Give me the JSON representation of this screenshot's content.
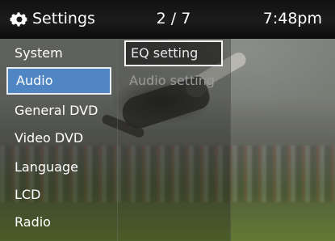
{
  "header": {
    "title": "Settings",
    "page": "2 / 7",
    "time": "7:48pm",
    "icon": "gear-icon"
  },
  "menu": {
    "items": [
      {
        "label": "System"
      },
      {
        "label": "Audio",
        "selected": true
      },
      {
        "label": "General DVD"
      },
      {
        "label": "Video DVD"
      },
      {
        "label": "Language"
      },
      {
        "label": "LCD"
      },
      {
        "label": "Radio"
      }
    ]
  },
  "submenu": {
    "items": [
      {
        "label": "EQ setting",
        "focused": true
      },
      {
        "label": "Audio setting"
      }
    ]
  },
  "colors": {
    "selection": "#4f86c3",
    "header": "#111111"
  }
}
